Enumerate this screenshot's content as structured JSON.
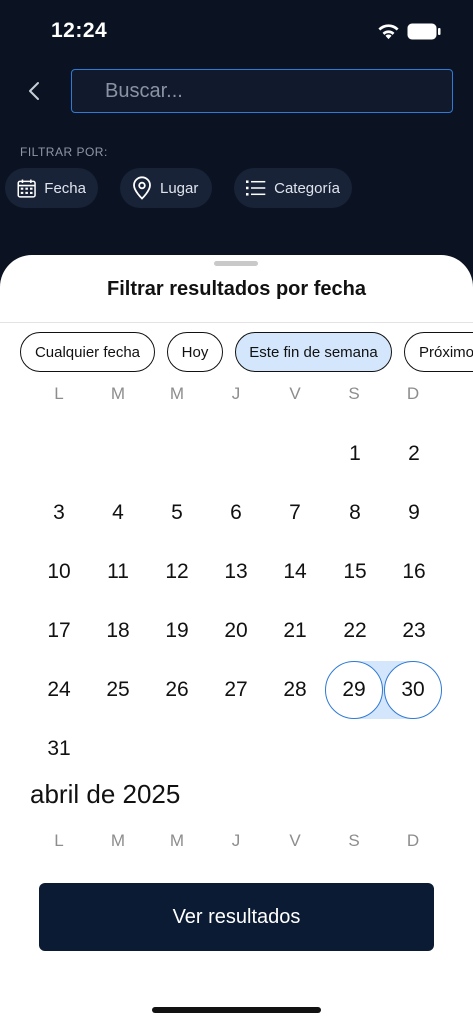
{
  "status": {
    "time": "12:24"
  },
  "search": {
    "placeholder": "Buscar..."
  },
  "filters": {
    "label": "FILTRAR POR:",
    "chips": [
      {
        "label": "Fecha",
        "icon": "calendar-icon"
      },
      {
        "label": "Lugar",
        "icon": "location-pin-icon"
      },
      {
        "label": "Categoría",
        "icon": "list-icon"
      }
    ]
  },
  "sheet": {
    "title": "Filtrar resultados por fecha",
    "quick_filters": [
      "Cualquier fecha",
      "Hoy",
      "Este fin de semana",
      "Próximo"
    ],
    "active_quick_filter": "Este fin de semana"
  },
  "calendar": {
    "weekdays": [
      "L",
      "M",
      "M",
      "J",
      "V",
      "S",
      "D"
    ],
    "march_days": [
      "1",
      "2",
      "3",
      "4",
      "5",
      "6",
      "7",
      "8",
      "9",
      "10",
      "11",
      "12",
      "13",
      "14",
      "15",
      "16",
      "17",
      "18",
      "19",
      "20",
      "21",
      "22",
      "23",
      "24",
      "25",
      "26",
      "27",
      "28",
      "29",
      "30",
      "31"
    ],
    "selected_days": [
      "29",
      "30"
    ],
    "next_month_title": "abril de 2025"
  },
  "cta": {
    "label": "Ver resultados"
  },
  "colors": {
    "accent": "#2f7ad6",
    "selection": "#d3e6fb",
    "header_bg": "#0b1322",
    "button_bg": "#0b1b33"
  }
}
